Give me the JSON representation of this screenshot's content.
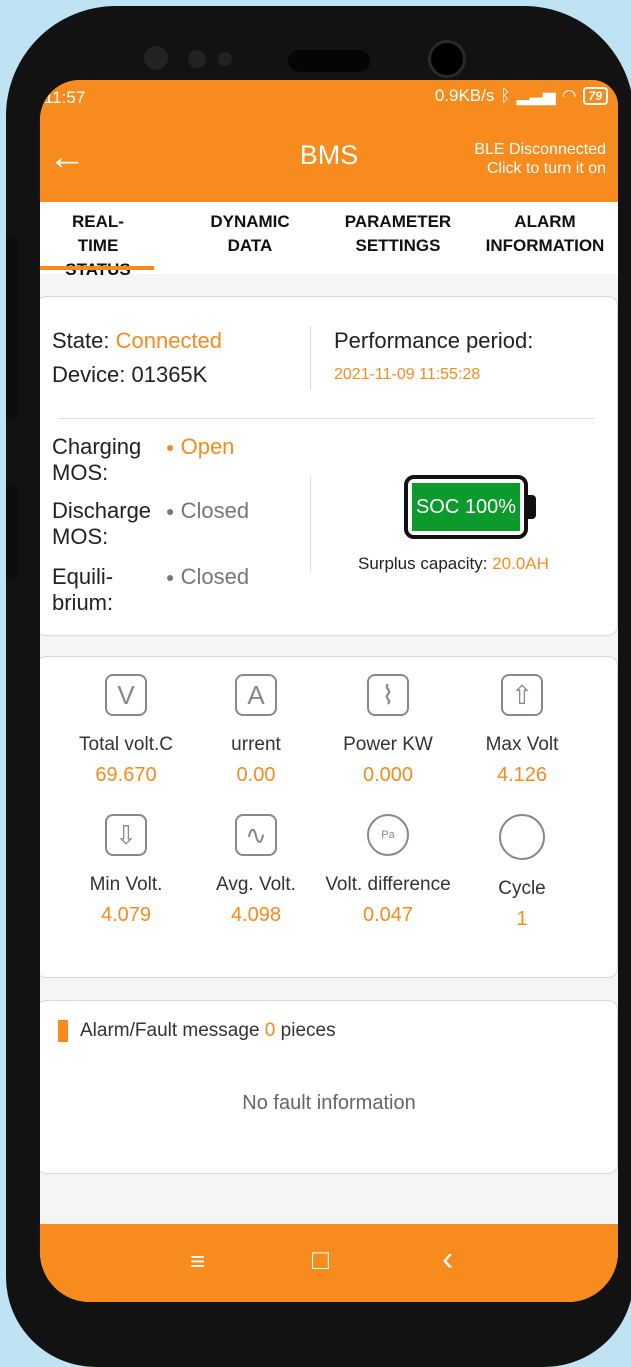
{
  "status_bar": {
    "time": "11:57",
    "net_speed": "0.9KB/s",
    "battery": "79"
  },
  "appbar": {
    "back_glyph": "←",
    "title": "BMS",
    "ble_line1": "BLE Disconnected",
    "ble_line2": "Click to turn it on"
  },
  "tabs": [
    {
      "line1": "REAL-TIME",
      "line2": "STATUS"
    },
    {
      "line1": "DYNAMIC",
      "line2": "DATA"
    },
    {
      "line1": "PARAMETER",
      "line2": "SETTINGS"
    },
    {
      "line1": "ALARM",
      "line2": "INFORMATION"
    }
  ],
  "status_card": {
    "state_label": "State:",
    "state_value": "Connected",
    "device_label": "Device:",
    "device_value": "01365K",
    "period_label": "Performance period:",
    "period_value": "2021-11-09  11:55:28",
    "mos": [
      {
        "label1": "Charging",
        "label2": "MOS:",
        "dot": "●",
        "value": "Open",
        "active": true
      },
      {
        "label1": "Discharge",
        "label2": "MOS:",
        "dot": "●",
        "value": "Closed",
        "active": false
      },
      {
        "label1": "Equili-",
        "label2": "brium:",
        "dot": "●",
        "value": "Closed",
        "active": false
      }
    ],
    "soc_text": "SOC 100%",
    "soc_level": 100,
    "surplus_label": "Surplus capacity:",
    "surplus_value": "20.0AH"
  },
  "metrics": [
    {
      "icon": "voltage-icon",
      "glyph": "V",
      "name": "Total volt.C",
      "value": "69.670"
    },
    {
      "icon": "current-icon",
      "glyph": "A",
      "name": "urrent",
      "value": "0.00"
    },
    {
      "icon": "power-icon",
      "glyph": "⌇",
      "name": "Power KW",
      "value": "0.000"
    },
    {
      "icon": "max-volt-icon",
      "glyph": "⇧",
      "name": "Max Volt",
      "value": "4.126"
    },
    {
      "icon": "min-volt-icon",
      "glyph": "⇩",
      "name": "Min Volt.",
      "value": "4.079"
    },
    {
      "icon": "avg-volt-icon",
      "glyph": "∿",
      "name": "Avg. Volt.",
      "value": "4.098"
    },
    {
      "icon": "gauge-icon",
      "glyph": "Pa",
      "name": "Volt. difference",
      "value": "0.047"
    },
    {
      "icon": "cycle-icon",
      "glyph": "",
      "name": "Cycle",
      "value": "1"
    }
  ],
  "alarm": {
    "prefix": "Alarm/Fault message",
    "count": "0",
    "suffix": "pieces",
    "empty_text": "No fault information"
  },
  "navbar": {
    "menu": "≡",
    "home": "□",
    "back": "‹"
  },
  "colors": {
    "accent": "#f78b1e",
    "soc_fill": "#0c9a2c"
  }
}
